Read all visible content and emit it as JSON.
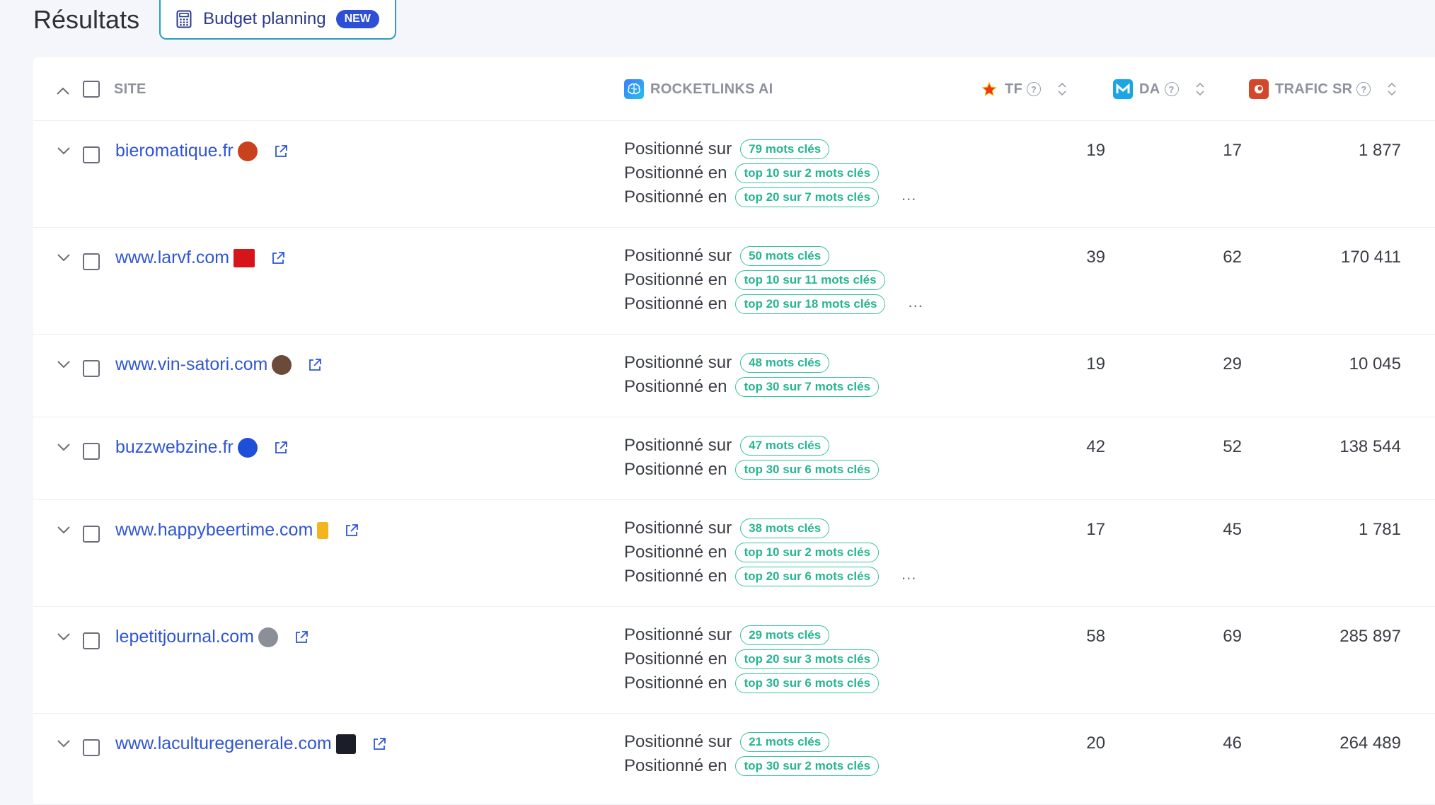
{
  "header": {
    "title": "Résultats",
    "budget_label": "Budget planning",
    "badge": "NEW"
  },
  "table": {
    "columns": {
      "site": "SITE",
      "ai": "ROCKETLINKS AI",
      "tf": "TF",
      "da": "DA",
      "trafic": "TRAFIC SR"
    },
    "help_glyph": "?",
    "rows": [
      {
        "site": "bieromatique.fr",
        "favicon": "beer-mug-icon",
        "lines": [
          {
            "label": "Positionné sur",
            "pill": "79 mots clés"
          },
          {
            "label": "Positionné en",
            "pill": "top 10 sur 2 mots clés"
          },
          {
            "label": "Positionné en",
            "pill": "top 20 sur 7 mots clés"
          }
        ],
        "more": "...",
        "tf": "19",
        "da": "17",
        "trafic": "1 877"
      },
      {
        "site": "www.larvf.com",
        "favicon": "vin-logo-icon",
        "lines": [
          {
            "label": "Positionné sur",
            "pill": "50 mots clés"
          },
          {
            "label": "Positionné en",
            "pill": "top 10 sur 11 mots clés"
          },
          {
            "label": "Positionné en",
            "pill": "top 20 sur 18 mots clés"
          }
        ],
        "more": "...",
        "tf": "39",
        "da": "62",
        "trafic": "170 411"
      },
      {
        "site": "www.vin-satori.com",
        "favicon": "satori-logo-icon",
        "lines": [
          {
            "label": "Positionné sur",
            "pill": "48 mots clés"
          },
          {
            "label": "Positionné en",
            "pill": "top 30 sur 7 mots clés"
          }
        ],
        "more": "",
        "tf": "19",
        "da": "29",
        "trafic": "10 045"
      },
      {
        "site": "buzzwebzine.fr",
        "favicon": "buzz-b-icon",
        "lines": [
          {
            "label": "Positionné sur",
            "pill": "47 mots clés"
          },
          {
            "label": "Positionné en",
            "pill": "top 30 sur 6 mots clés"
          }
        ],
        "more": "",
        "tf": "42",
        "da": "52",
        "trafic": "138 544"
      },
      {
        "site": "www.happybeertime.com",
        "favicon": "beer-glass-icon",
        "lines": [
          {
            "label": "Positionné sur",
            "pill": "38 mots clés"
          },
          {
            "label": "Positionné en",
            "pill": "top 10 sur 2 mots clés"
          },
          {
            "label": "Positionné en",
            "pill": "top 20 sur 6 mots clés"
          }
        ],
        "more": "...",
        "tf": "17",
        "da": "45",
        "trafic": "1 781"
      },
      {
        "site": "lepetitjournal.com",
        "favicon": "petitjournal-logo-icon",
        "lines": [
          {
            "label": "Positionné sur",
            "pill": "29 mots clés"
          },
          {
            "label": "Positionné en",
            "pill": "top 20 sur 3 mots clés"
          },
          {
            "label": "Positionné en",
            "pill": "top 30 sur 6 mots clés"
          }
        ],
        "more": "",
        "tf": "58",
        "da": "69",
        "trafic": "285 897"
      },
      {
        "site": "www.laculturegenerale.com",
        "favicon": "culture-logo-icon",
        "lines": [
          {
            "label": "Positionné sur",
            "pill": "21 mots clés"
          },
          {
            "label": "Positionné en",
            "pill": "top 30 sur 2 mots clés"
          }
        ],
        "more": "",
        "tf": "20",
        "da": "46",
        "trafic": "264 489"
      }
    ]
  },
  "colors": {
    "link": "#2f55d4",
    "pill_border": "#38c2a0",
    "badge": "#2d4fd6",
    "budget_border": "#2a9fb8"
  }
}
